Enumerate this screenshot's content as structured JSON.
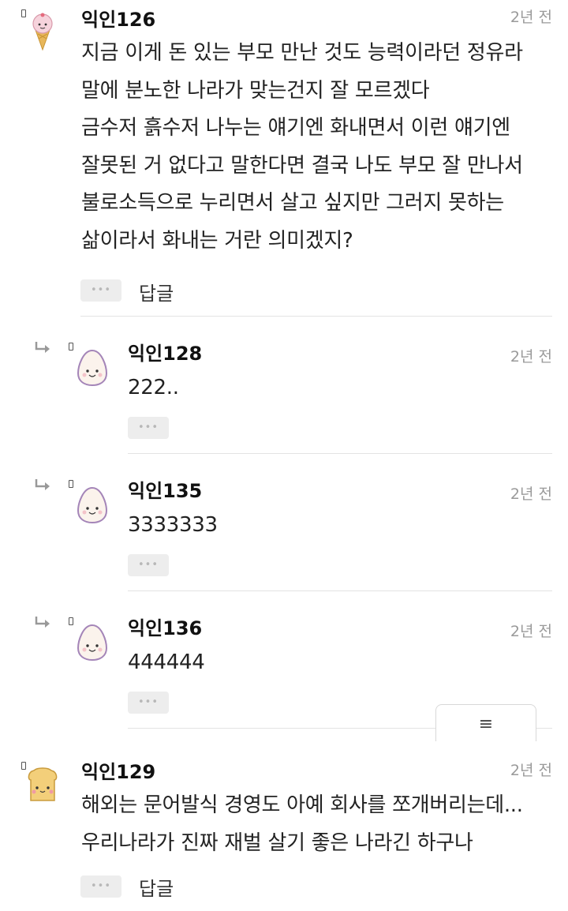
{
  "comments": [
    {
      "author": "익인126",
      "time": "2년 전",
      "avatar_icon": "ice-cream-cone-icon",
      "lines": [
        "지금 이게 돈 있는 부모 만난 것도 능력이라던 정유라",
        "말에 분노한 나라가 맞는건지 잘 모르겠다",
        "금수저 흙수저 나누는 얘기엔 화내면서 이런 얘기엔",
        "잘못된 거 없다고 말한다면 결국 나도 부모 잘 만나서",
        "불로소득으로 누리면서 살고 싶지만 그러지 못하는",
        "삶이라서 화내는 거란 의미겠지?"
      ],
      "more_label": "•••",
      "reply_label": "답글",
      "replies": [
        {
          "author": "익인128",
          "time": "2년 전",
          "text": "222..",
          "avatar_icon": "egg-face-icon",
          "more_label": "•••"
        },
        {
          "author": "익인135",
          "time": "2년 전",
          "text": "3333333",
          "avatar_icon": "egg-face-icon",
          "more_label": "•••"
        },
        {
          "author": "익인136",
          "time": "2년 전",
          "text": "444444",
          "avatar_icon": "egg-face-icon",
          "more_label": "•••"
        }
      ]
    },
    {
      "author": "익인129",
      "time": "2년 전",
      "avatar_icon": "toast-bread-icon",
      "lines": [
        "해외는 문어발식 경영도 아예 회사를 쪼개버리는데...",
        "우리나라가 진짜 재벌 살기 좋은 나라긴 하구나"
      ],
      "more_label": "•••",
      "reply_label": "답글"
    }
  ],
  "menu_button_icon": "hamburger-menu-icon",
  "menu_button_label": "≡",
  "colors": {
    "divider": "#e3e3e3",
    "time": "#9a9a9a",
    "button_bg": "#ededed",
    "egg_outline": "#a485b8"
  }
}
